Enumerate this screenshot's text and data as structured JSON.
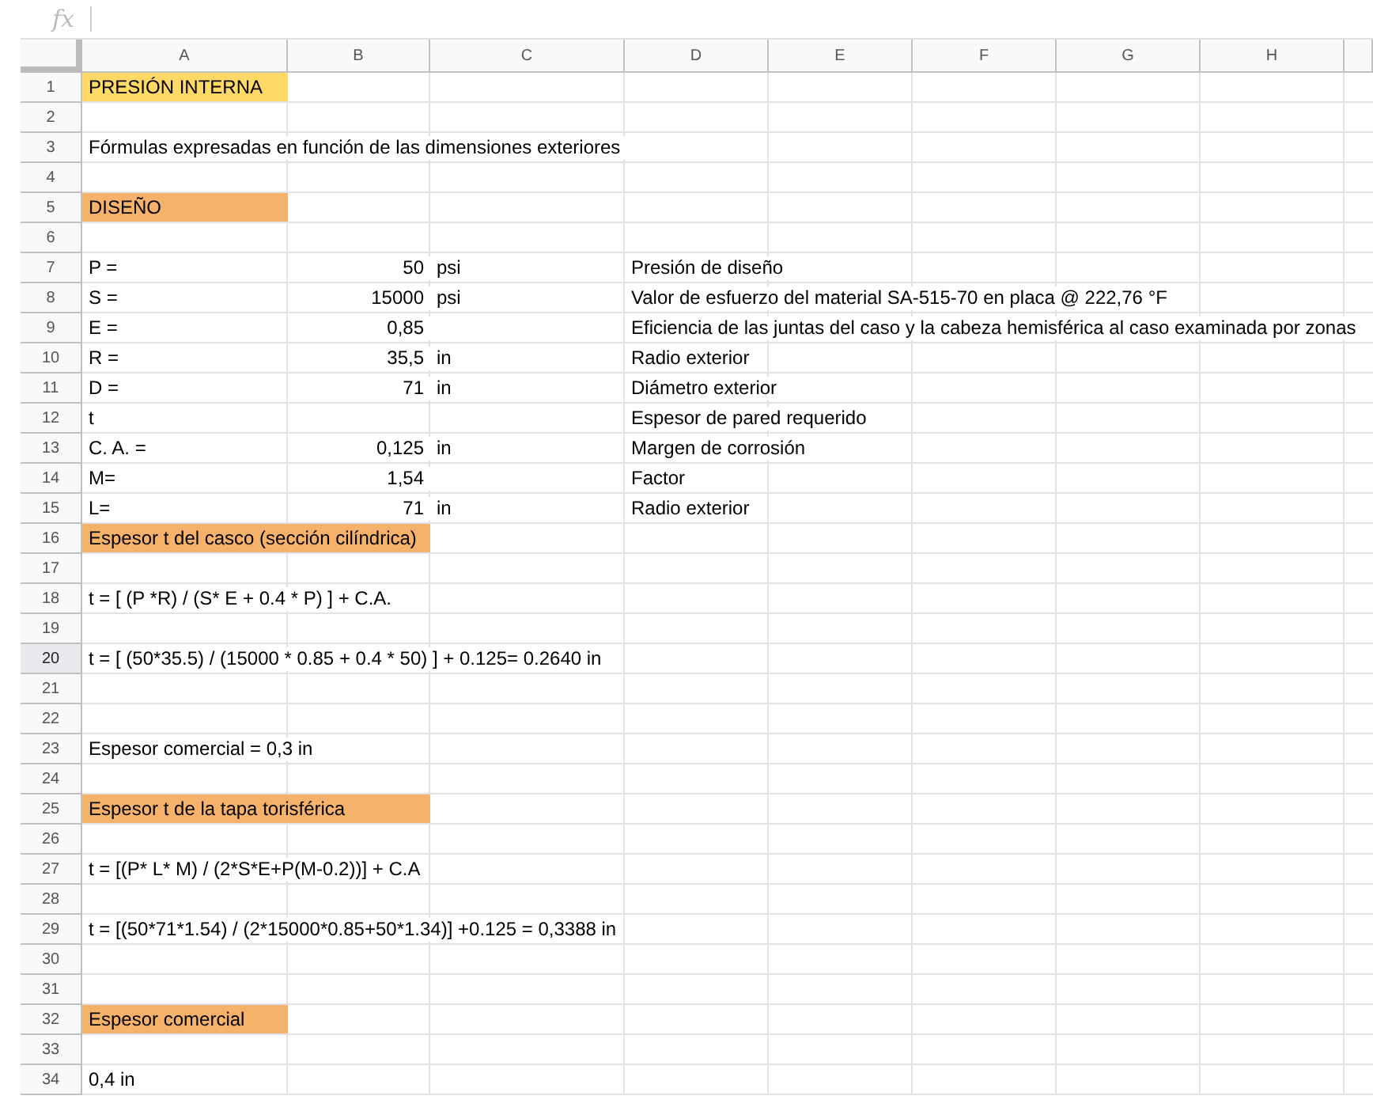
{
  "formula_bar": {
    "icon_text": "fx"
  },
  "columns": [
    "A",
    "B",
    "C",
    "D",
    "E",
    "F",
    "G",
    "H"
  ],
  "rows": [
    {
      "number": "1",
      "selected": false,
      "cells": {
        "A": {
          "text": "PRESIÓN INTERNA",
          "color": "#ffd966"
        }
      }
    },
    {
      "number": "2",
      "selected": false,
      "cells": {}
    },
    {
      "number": "3",
      "selected": false,
      "cells": {
        "A": {
          "text": "Fórmulas expresadas en función de las dimensiones exteriores"
        }
      }
    },
    {
      "number": "4",
      "selected": false,
      "cells": {}
    },
    {
      "number": "5",
      "selected": false,
      "cells": {
        "A": {
          "text": "DISEÑO",
          "color": "#f6b26b"
        }
      }
    },
    {
      "number": "6",
      "selected": false,
      "cells": {}
    },
    {
      "number": "7",
      "selected": false,
      "cells": {
        "A": {
          "text": "P ="
        },
        "B": {
          "text": "50"
        },
        "C": {
          "text": "psi"
        },
        "D": {
          "text": "Presión de diseño"
        }
      }
    },
    {
      "number": "8",
      "selected": false,
      "cells": {
        "A": {
          "text": "S ="
        },
        "B": {
          "text": "15000"
        },
        "C": {
          "text": "psi"
        },
        "D": {
          "text": "Valor de esfuerzo del material SA-515-70 en placa @ 222,76 °F"
        }
      }
    },
    {
      "number": "9",
      "selected": false,
      "cells": {
        "A": {
          "text": "E ="
        },
        "B": {
          "text": "0,85"
        },
        "D": {
          "text": "Eficiencia de las juntas del caso y la cabeza hemisférica al caso examinada por zonas"
        }
      }
    },
    {
      "number": "10",
      "selected": false,
      "cells": {
        "A": {
          "text": "R ="
        },
        "B": {
          "text": "35,5"
        },
        "C": {
          "text": "in"
        },
        "D": {
          "text": "Radio exterior"
        }
      }
    },
    {
      "number": "11",
      "selected": false,
      "cells": {
        "A": {
          "text": "D ="
        },
        "B": {
          "text": "71"
        },
        "C": {
          "text": "in"
        },
        "D": {
          "text": "Diámetro exterior"
        }
      }
    },
    {
      "number": "12",
      "selected": false,
      "cells": {
        "A": {
          "text": "t"
        },
        "D": {
          "text": "Espesor de pared requerido"
        }
      }
    },
    {
      "number": "13",
      "selected": false,
      "cells": {
        "A": {
          "text": "C. A. ="
        },
        "B": {
          "text": "0,125"
        },
        "C": {
          "text": "in"
        },
        "D": {
          "text": "Margen de corrosión"
        }
      }
    },
    {
      "number": "14",
      "selected": false,
      "cells": {
        "A": {
          "text": "M="
        },
        "B": {
          "text": "1,54"
        },
        "D": {
          "text": "Factor"
        }
      }
    },
    {
      "number": "15",
      "selected": false,
      "cells": {
        "A": {
          "text": "L="
        },
        "B": {
          "text": "71"
        },
        "C": {
          "text": "in"
        },
        "D": {
          "text": "Radio exterior"
        }
      }
    },
    {
      "number": "16",
      "selected": false,
      "cells": {
        "A": {
          "text": "Espesor t del casco (sección cilíndrica)",
          "color": "#f6b26b"
        },
        "B": {
          "color": "#f6b26b"
        }
      }
    },
    {
      "number": "17",
      "selected": false,
      "cells": {}
    },
    {
      "number": "18",
      "selected": false,
      "cells": {
        "A": {
          "text": "t = [ (P *R) / (S* E + 0.4 * P) ]  + C.A."
        }
      }
    },
    {
      "number": "19",
      "selected": false,
      "cells": {}
    },
    {
      "number": "20",
      "selected": true,
      "cells": {
        "A": {
          "text": "t = [ (50*35.5) / (15000 * 0.85 + 0.4 * 50) ] + 0.125=  0.2640 in"
        }
      }
    },
    {
      "number": "21",
      "selected": false,
      "cells": {}
    },
    {
      "number": "22",
      "selected": false,
      "cells": {}
    },
    {
      "number": "23",
      "selected": false,
      "cells": {
        "A": {
          "text": "Espesor comercial = 0,3 in"
        }
      }
    },
    {
      "number": "24",
      "selected": false,
      "cells": {}
    },
    {
      "number": "25",
      "selected": false,
      "cells": {
        "A": {
          "text": "Espesor t de la tapa torisférica",
          "color": "#f6b26b"
        },
        "B": {
          "color": "#f6b26b"
        }
      }
    },
    {
      "number": "26",
      "selected": false,
      "cells": {}
    },
    {
      "number": "27",
      "selected": false,
      "cells": {
        "A": {
          "text": "t = [(P* L* M) / (2*S*E+P(M-0.2))] + C.A"
        }
      }
    },
    {
      "number": "28",
      "selected": false,
      "cells": {}
    },
    {
      "number": "29",
      "selected": false,
      "cells": {
        "A": {
          "text": "t = [(50*71*1.54) / (2*15000*0.85+50*1.34)] +0.125 = 0,3388 in"
        }
      }
    },
    {
      "number": "30",
      "selected": false,
      "cells": {}
    },
    {
      "number": "31",
      "selected": false,
      "cells": {}
    },
    {
      "number": "32",
      "selected": false,
      "cells": {
        "A": {
          "text": "Espesor comercial",
          "color": "#f6b26b"
        }
      }
    },
    {
      "number": "33",
      "selected": false,
      "cells": {}
    },
    {
      "number": "34",
      "selected": false,
      "cells": {
        "A": {
          "text": "0,4 in"
        }
      }
    }
  ]
}
